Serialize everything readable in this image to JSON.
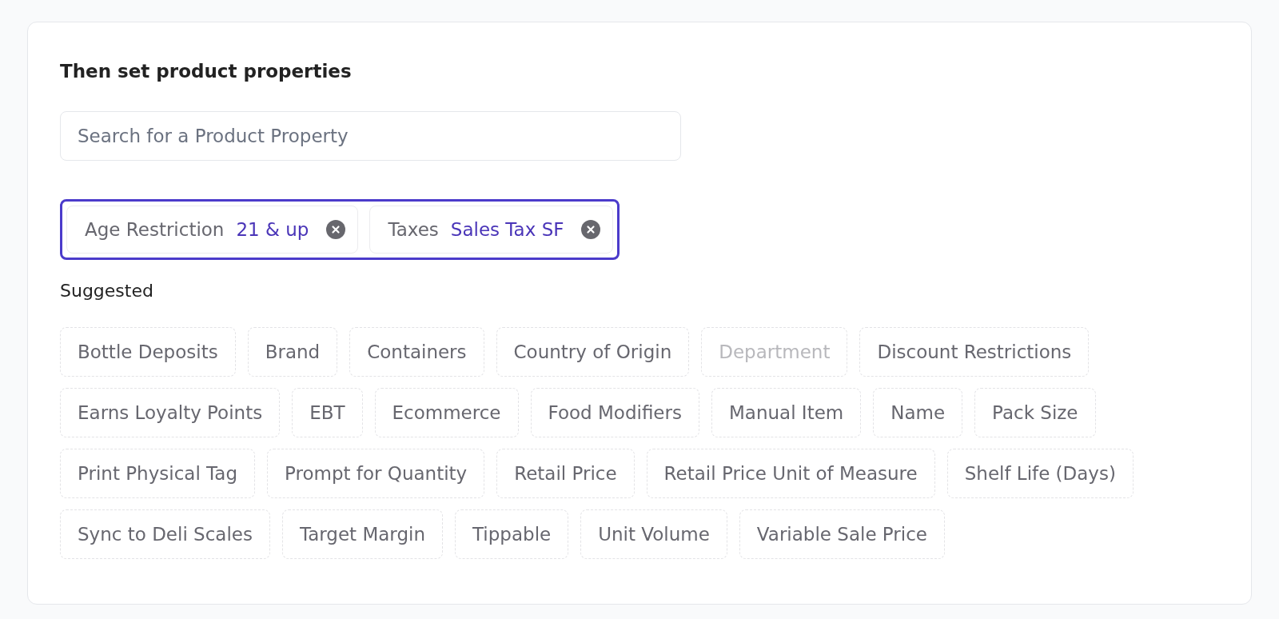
{
  "heading": "Then set product properties",
  "search": {
    "placeholder": "Search for a Product Property"
  },
  "selected_properties": {
    "focused": true,
    "items": [
      {
        "label": "Age Restriction",
        "value": "21 & up"
      },
      {
        "label": "Taxes",
        "value": "Sales Tax SF"
      }
    ]
  },
  "suggested": {
    "title": "Suggested",
    "items": [
      {
        "label": "Bottle Deposits",
        "disabled": false
      },
      {
        "label": "Brand",
        "disabled": false
      },
      {
        "label": "Containers",
        "disabled": false
      },
      {
        "label": "Country of Origin",
        "disabled": false
      },
      {
        "label": "Department",
        "disabled": true
      },
      {
        "label": "Discount Restrictions",
        "disabled": false
      },
      {
        "label": "Earns Loyalty Points",
        "disabled": false
      },
      {
        "label": "EBT",
        "disabled": false
      },
      {
        "label": "Ecommerce",
        "disabled": false
      },
      {
        "label": "Food Modifiers",
        "disabled": false
      },
      {
        "label": "Manual Item",
        "disabled": false
      },
      {
        "label": "Name",
        "disabled": false
      },
      {
        "label": "Pack Size",
        "disabled": false
      },
      {
        "label": "Print Physical Tag",
        "disabled": false
      },
      {
        "label": "Prompt for Quantity",
        "disabled": false
      },
      {
        "label": "Retail Price",
        "disabled": false
      },
      {
        "label": "Retail Price Unit of Measure",
        "disabled": false
      },
      {
        "label": "Shelf Life (Days)",
        "disabled": false
      },
      {
        "label": "Sync to Deli Scales",
        "disabled": false
      },
      {
        "label": "Target Margin",
        "disabled": false
      },
      {
        "label": "Tippable",
        "disabled": false
      },
      {
        "label": "Unit Volume",
        "disabled": false
      },
      {
        "label": "Variable Sale Price",
        "disabled": false
      }
    ]
  }
}
